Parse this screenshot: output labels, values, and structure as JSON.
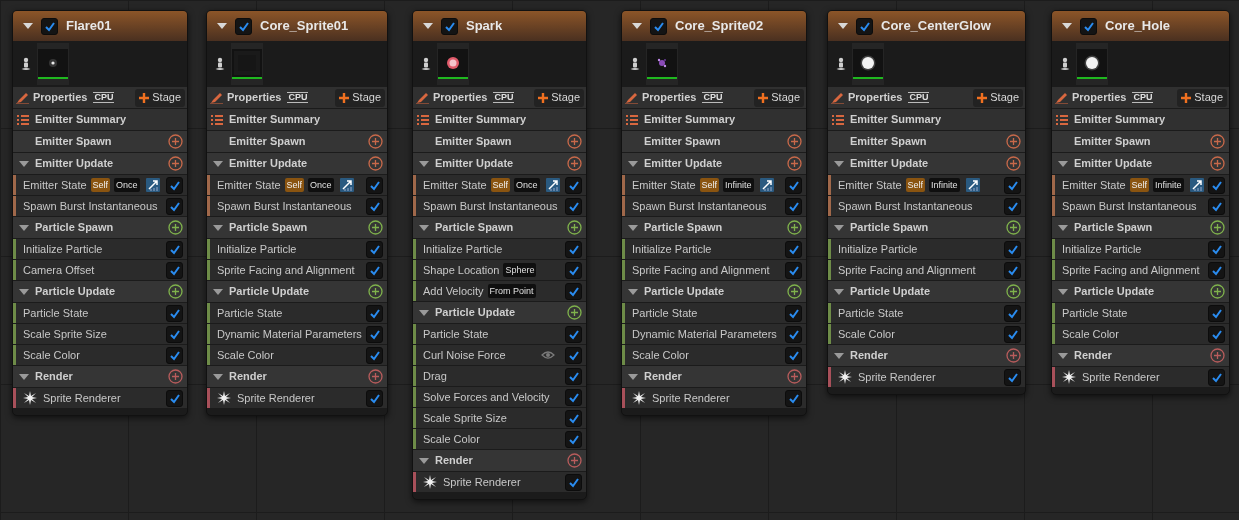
{
  "emitters": [
    {
      "name": "Flare01",
      "enabled": true,
      "thumbnail": {
        "kind": "picture"
      },
      "properties": "Properties",
      "sim_target": "CPU",
      "stage_button": "Stage",
      "summary": "Emitter Summary",
      "groups": [
        {
          "title": "Emitter Spawn",
          "kind": "emitter"
        },
        {
          "title": "Emitter Update",
          "kind": "emitter",
          "items": [
            {
              "label": "Emitter State",
              "enabled": true,
              "tags": [
                {
                  "text": "Self",
                  "kind": "self"
                },
                {
                  "text": "Once",
                  "kind": "mode"
                }
              ],
              "curve_icon": true
            },
            {
              "label": "Spawn Burst Instantaneous",
              "enabled": true
            }
          ]
        },
        {
          "title": "Particle Spawn",
          "kind": "particle",
          "items": [
            {
              "label": "Initialize Particle",
              "enabled": true
            },
            {
              "label": "Camera Offset",
              "enabled": true
            }
          ]
        },
        {
          "title": "Particle Update",
          "kind": "particle",
          "items": [
            {
              "label": "Particle State",
              "enabled": true
            },
            {
              "label": "Scale Sprite Size",
              "enabled": true
            },
            {
              "label": "Scale Color",
              "enabled": true
            }
          ]
        },
        {
          "title": "Render",
          "kind": "render",
          "items": [
            {
              "label": "Sprite Renderer",
              "enabled": true,
              "renderer": true
            }
          ]
        }
      ]
    },
    {
      "name": "Core_Sprite01",
      "enabled": true,
      "thumbnail": {
        "kind": "picture"
      },
      "properties": "Properties",
      "sim_target": "CPU",
      "stage_button": "Stage",
      "summary": "Emitter Summary",
      "groups": [
        {
          "title": "Emitter Spawn",
          "kind": "emitter"
        },
        {
          "title": "Emitter Update",
          "kind": "emitter",
          "items": [
            {
              "label": "Emitter State",
              "enabled": true,
              "tags": [
                {
                  "text": "Self",
                  "kind": "self"
                },
                {
                  "text": "Once",
                  "kind": "mode"
                }
              ],
              "curve_icon": true
            },
            {
              "label": "Spawn Burst Instantaneous",
              "enabled": true
            }
          ]
        },
        {
          "title": "Particle Spawn",
          "kind": "particle",
          "items": [
            {
              "label": "Initialize Particle",
              "enabled": true
            },
            {
              "label": "Sprite Facing and Alignment",
              "enabled": true
            }
          ]
        },
        {
          "title": "Particle Update",
          "kind": "particle",
          "items": [
            {
              "label": "Particle State",
              "enabled": true
            },
            {
              "label": "Dynamic Material Parameters",
              "enabled": true
            },
            {
              "label": "Scale Color",
              "enabled": true
            }
          ]
        },
        {
          "title": "Render",
          "kind": "render",
          "items": [
            {
              "label": "Sprite Renderer",
              "enabled": true,
              "renderer": true
            }
          ]
        }
      ]
    },
    {
      "name": "Spark",
      "enabled": true,
      "thumbnail": {
        "kind": "picture"
      },
      "properties": "Properties",
      "sim_target": "CPU",
      "stage_button": "Stage",
      "summary": "Emitter Summary",
      "groups": [
        {
          "title": "Emitter Spawn",
          "kind": "emitter"
        },
        {
          "title": "Emitter Update",
          "kind": "emitter",
          "items": [
            {
              "label": "Emitter State",
              "enabled": true,
              "tags": [
                {
                  "text": "Self",
                  "kind": "self"
                },
                {
                  "text": "Once",
                  "kind": "mode"
                }
              ],
              "curve_icon": true
            },
            {
              "label": "Spawn Burst Instantaneous",
              "enabled": true
            }
          ]
        },
        {
          "title": "Particle Spawn",
          "kind": "particle",
          "items": [
            {
              "label": "Initialize Particle",
              "enabled": true
            },
            {
              "label": "Shape Location",
              "enabled": true,
              "tags": [
                {
                  "text": "Sphere",
                  "kind": "mode"
                }
              ]
            },
            {
              "label": "Add Velocity",
              "enabled": true,
              "tags": [
                {
                  "text": "From Point",
                  "kind": "mode"
                }
              ]
            }
          ]
        },
        {
          "title": "Particle Update",
          "kind": "particle",
          "items": [
            {
              "label": "Particle State",
              "enabled": true
            },
            {
              "label": "Curl Noise Force",
              "enabled": true,
              "eye_icon": true
            },
            {
              "label": "Drag",
              "enabled": true
            },
            {
              "label": "Solve Forces and Velocity",
              "enabled": true
            },
            {
              "label": "Scale Sprite Size",
              "enabled": true
            },
            {
              "label": "Scale Color",
              "enabled": true
            }
          ]
        },
        {
          "title": "Render",
          "kind": "render",
          "items": [
            {
              "label": "Sprite Renderer",
              "enabled": true,
              "renderer": true
            }
          ]
        }
      ]
    },
    {
      "name": "Core_Sprite02",
      "enabled": true,
      "thumbnail": {
        "kind": "picture"
      },
      "properties": "Properties",
      "sim_target": "CPU",
      "stage_button": "Stage",
      "summary": "Emitter Summary",
      "groups": [
        {
          "title": "Emitter Spawn",
          "kind": "emitter"
        },
        {
          "title": "Emitter Update",
          "kind": "emitter",
          "items": [
            {
              "label": "Emitter State",
              "enabled": true,
              "tags": [
                {
                  "text": "Self",
                  "kind": "self"
                },
                {
                  "text": "Infinite",
                  "kind": "mode"
                }
              ],
              "curve_icon": true
            },
            {
              "label": "Spawn Burst Instantaneous",
              "enabled": true
            }
          ]
        },
        {
          "title": "Particle Spawn",
          "kind": "particle",
          "items": [
            {
              "label": "Initialize Particle",
              "enabled": true
            },
            {
              "label": "Sprite Facing and Alignment",
              "enabled": true
            }
          ]
        },
        {
          "title": "Particle Update",
          "kind": "particle",
          "items": [
            {
              "label": "Particle State",
              "enabled": true
            },
            {
              "label": "Dynamic Material Parameters",
              "enabled": true
            },
            {
              "label": "Scale Color",
              "enabled": true
            }
          ]
        },
        {
          "title": "Render",
          "kind": "render",
          "items": [
            {
              "label": "Sprite Renderer",
              "enabled": true,
              "renderer": true
            }
          ]
        }
      ]
    },
    {
      "name": "Core_CenterGlow",
      "enabled": true,
      "thumbnail": {
        "kind": "picture"
      },
      "properties": "Properties",
      "sim_target": "CPU",
      "stage_button": "Stage",
      "summary": "Emitter Summary",
      "groups": [
        {
          "title": "Emitter Spawn",
          "kind": "emitter"
        },
        {
          "title": "Emitter Update",
          "kind": "emitter",
          "items": [
            {
              "label": "Emitter State",
              "enabled": true,
              "tags": [
                {
                  "text": "Self",
                  "kind": "self"
                },
                {
                  "text": "Infinite",
                  "kind": "mode"
                }
              ],
              "curve_icon": true
            },
            {
              "label": "Spawn Burst Instantaneous",
              "enabled": true
            }
          ]
        },
        {
          "title": "Particle Spawn",
          "kind": "particle",
          "items": [
            {
              "label": "Initialize Particle",
              "enabled": true
            },
            {
              "label": "Sprite Facing and Alignment",
              "enabled": true
            }
          ]
        },
        {
          "title": "Particle Update",
          "kind": "particle",
          "items": [
            {
              "label": "Particle State",
              "enabled": true
            },
            {
              "label": "Scale Color",
              "enabled": true
            }
          ]
        },
        {
          "title": "Render",
          "kind": "render",
          "items": [
            {
              "label": "Sprite Renderer",
              "enabled": true,
              "renderer": true
            }
          ]
        }
      ]
    },
    {
      "name": "Core_Hole",
      "enabled": true,
      "thumbnail": {
        "kind": "picture"
      },
      "properties": "Properties",
      "sim_target": "CPU",
      "stage_button": "Stage",
      "summary": "Emitter Summary",
      "groups": [
        {
          "title": "Emitter Spawn",
          "kind": "emitter"
        },
        {
          "title": "Emitter Update",
          "kind": "emitter",
          "items": [
            {
              "label": "Emitter State",
              "enabled": true,
              "tags": [
                {
                  "text": "Self",
                  "kind": "self"
                },
                {
                  "text": "Infinite",
                  "kind": "mode"
                }
              ],
              "curve_icon": true
            },
            {
              "label": "Spawn Burst Instantaneous",
              "enabled": true
            }
          ]
        },
        {
          "title": "Particle Spawn",
          "kind": "particle",
          "items": [
            {
              "label": "Initialize Particle",
              "enabled": true
            },
            {
              "label": "Sprite Facing and Alignment",
              "enabled": true
            }
          ]
        },
        {
          "title": "Particle Update",
          "kind": "particle",
          "items": [
            {
              "label": "Particle State",
              "enabled": true
            },
            {
              "label": "Scale Color",
              "enabled": true
            }
          ]
        },
        {
          "title": "Render",
          "kind": "render",
          "items": [
            {
              "label": "Sprite Renderer",
              "enabled": true,
              "renderer": true
            }
          ]
        }
      ]
    }
  ]
}
